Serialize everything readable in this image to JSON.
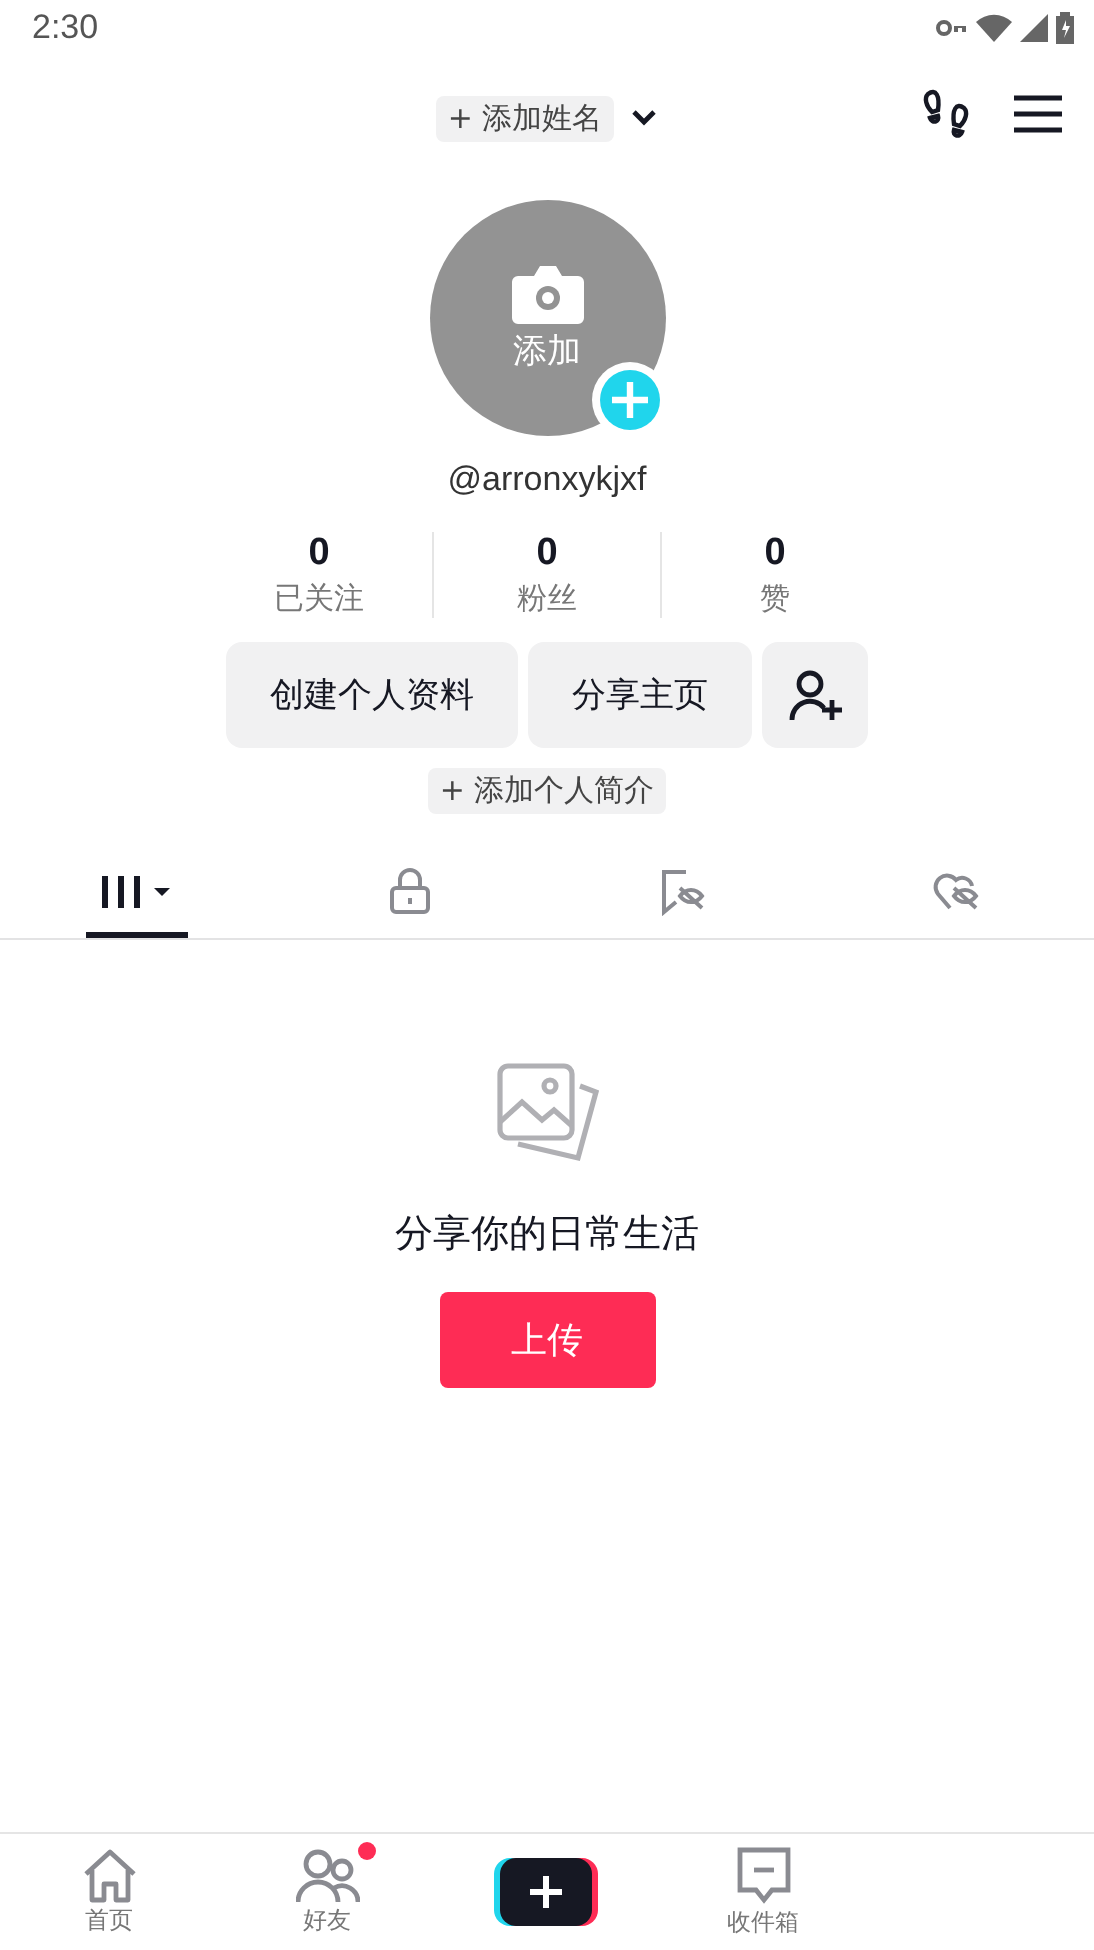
{
  "status_bar": {
    "time": "2:30"
  },
  "header": {
    "name_chip": "+ 添加姓名"
  },
  "profile": {
    "avatar_label": "添加",
    "username": "@arronxykjxf"
  },
  "stats": [
    {
      "value": "0",
      "label": "已关注"
    },
    {
      "value": "0",
      "label": "粉丝"
    },
    {
      "value": "0",
      "label": "赞"
    }
  ],
  "buttons": [
    "创建个人资料",
    "分享主页"
  ],
  "bio_chip": "+ 添加个人简介",
  "tabs": [
    {
      "kind": "grid",
      "selected": true
    },
    {
      "kind": "lock",
      "selected": false
    },
    {
      "kind": "bookmark",
      "selected": false
    },
    {
      "kind": "heart",
      "selected": false
    }
  ],
  "empty_state": {
    "message": "分享你的日常生活",
    "button": "上传"
  },
  "bottom_nav": [
    {
      "kind": "home",
      "label": "首页",
      "badge": false
    },
    {
      "kind": "friends",
      "label": "好友",
      "badge": true
    },
    {
      "kind": "create"
    },
    {
      "kind": "inbox",
      "label": "收件箱",
      "badge": false
    }
  ]
}
